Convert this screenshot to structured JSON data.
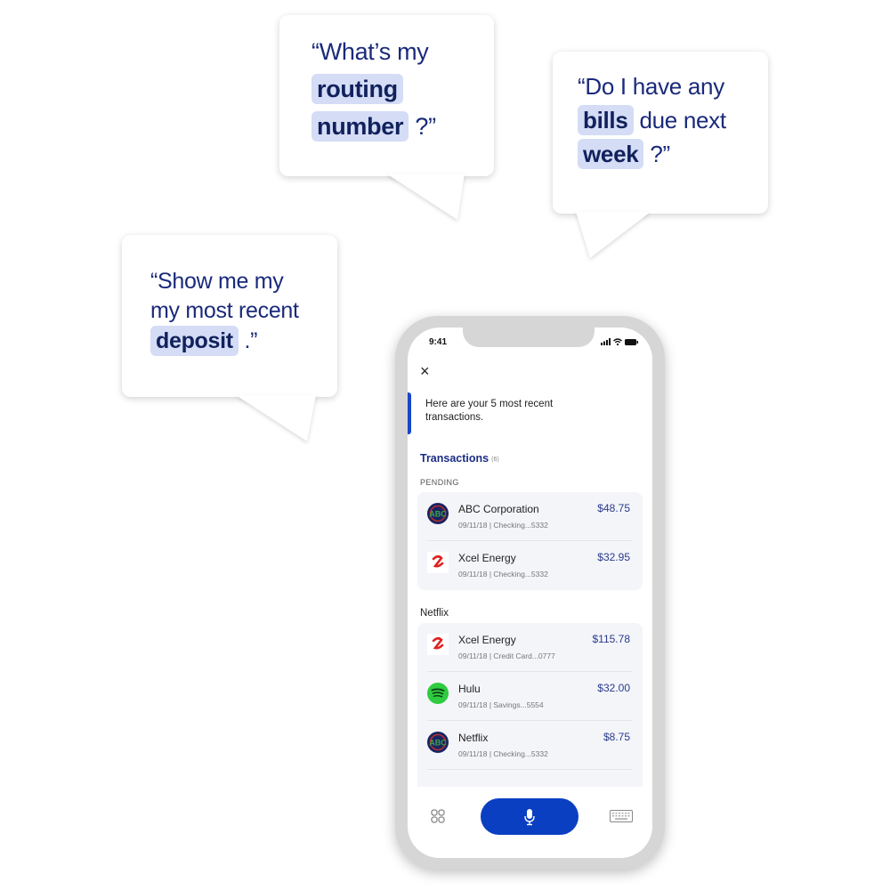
{
  "bubbles": {
    "routing": {
      "line1": "“What’s my",
      "highlight1": "routing",
      "highlight2": "number",
      "suffix": "?”"
    },
    "bills": {
      "line1": "“Do I have any",
      "highlight1": "bills",
      "after_highlight1": "due next",
      "highlight2": "week",
      "suffix": "?”"
    },
    "deposit": {
      "line1": "“Show me my",
      "line2": "my most recent",
      "highlight1": "deposit",
      "suffix": ".”"
    }
  },
  "phone": {
    "status_time": "9:41",
    "close_icon": "×",
    "message": "Here are your 5 most recent transactions.",
    "section_title": "Transactions",
    "section_count": "(6)",
    "groups": [
      {
        "label": "PENDING",
        "rows": [
          {
            "logo": "abc-logo",
            "name": "ABC Corporation",
            "meta": "09/11/18 | Checking...5332",
            "amount": "$48.75"
          },
          {
            "logo": "xcel-logo",
            "name": "Xcel Energy",
            "meta": "09/11/18 | Checking...5332",
            "amount": "$32.95"
          }
        ]
      },
      {
        "label": "Netflix",
        "rows": [
          {
            "logo": "xcel-logo",
            "name": "Xcel Energy",
            "meta": "09/11/18 | Credit Card...0777",
            "amount": "$115.78"
          },
          {
            "logo": "spotify-logo",
            "name": "Hulu",
            "meta": "09/11/18 | Savings...5554",
            "amount": "$32.00"
          },
          {
            "logo": "abc-logo",
            "name": "Netflix",
            "meta": "09/11/18 | Checking...5332",
            "amount": "$8.75"
          }
        ]
      }
    ],
    "bottom_bar": {
      "left_icon": "grid-icon",
      "center_icon": "microphone-icon",
      "right_icon": "keyboard-icon"
    },
    "colors": {
      "accent": "#0a3fc2",
      "title": "#1c2d86",
      "amount": "#2a3a8c",
      "highlight_bg": "#d4dcf6",
      "bubble_text": "#1a2a7a"
    }
  }
}
